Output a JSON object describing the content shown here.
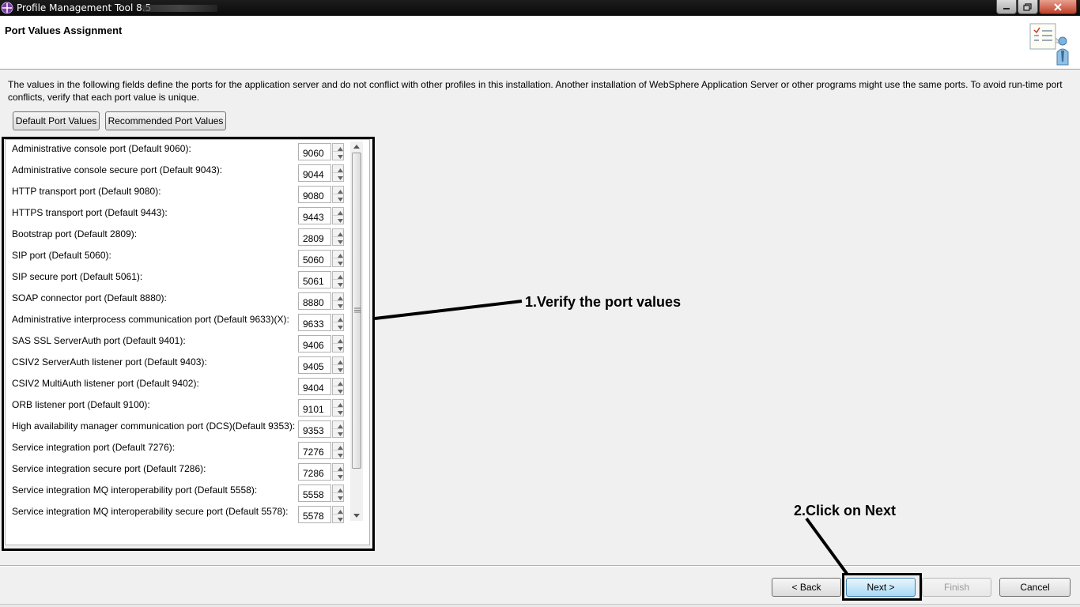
{
  "window": {
    "title": "Profile Management Tool 8.5"
  },
  "header": {
    "title": "Port Values Assignment"
  },
  "description": "The values in the following fields define the ports for the application server and do not conflict with other profiles in this installation. Another installation of WebSphere Application Server or other programs might use the same ports. To avoid run-time port conflicts, verify that each port value is unique.",
  "buttons": {
    "default_ports": "Default Port Values",
    "recommended_ports": "Recommended Port Values",
    "back": "< Back",
    "next": "Next >",
    "finish": "Finish",
    "cancel": "Cancel"
  },
  "ports": [
    {
      "label": "Administrative console port (Default 9060):",
      "value": "9060"
    },
    {
      "label": "Administrative console secure port (Default 9043):",
      "value": "9044"
    },
    {
      "label": "HTTP transport port (Default 9080):",
      "value": "9080"
    },
    {
      "label": "HTTPS transport port (Default 9443):",
      "value": "9443"
    },
    {
      "label": "Bootstrap port (Default 2809):",
      "value": "2809"
    },
    {
      "label": "SIP port (Default 5060):",
      "value": "5060"
    },
    {
      "label": "SIP secure port (Default 5061):",
      "value": "5061"
    },
    {
      "label": "SOAP connector port (Default 8880):",
      "value": "8880"
    },
    {
      "label": "Administrative interprocess communication port (Default 9633)(X):",
      "value": "9633"
    },
    {
      "label": "SAS SSL ServerAuth port (Default 9401):",
      "value": "9406"
    },
    {
      "label": "CSIV2 ServerAuth listener port (Default 9403):",
      "value": "9405"
    },
    {
      "label": "CSIV2 MultiAuth listener port (Default 9402):",
      "value": "9404"
    },
    {
      "label": "ORB listener port (Default 9100):",
      "value": "9101"
    },
    {
      "label": "High availability manager communication port (DCS)(Default 9353):",
      "value": "9353"
    },
    {
      "label": "Service integration port (Default 7276):",
      "value": "7276"
    },
    {
      "label": "Service integration secure port (Default 7286):",
      "value": "7286"
    },
    {
      "label": "Service integration MQ interoperability port (Default 5558):",
      "value": "5558"
    },
    {
      "label": "Service integration MQ interoperability secure port (Default 5578):",
      "value": "5578"
    }
  ],
  "annotations": {
    "step1": "1.Verify the port values",
    "step2": "2.Click on Next"
  }
}
